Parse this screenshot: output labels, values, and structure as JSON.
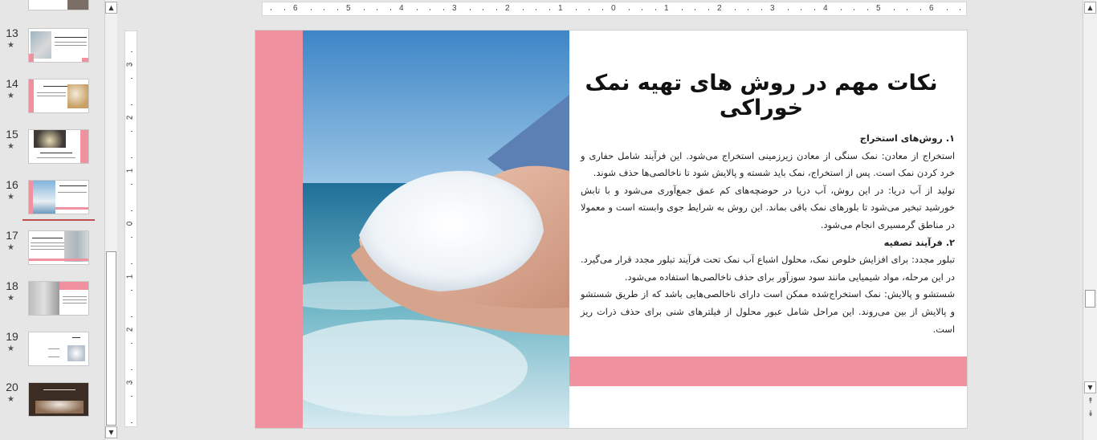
{
  "thumbnails": [
    {
      "number": "13",
      "star": "★"
    },
    {
      "number": "14",
      "star": "★"
    },
    {
      "number": "15",
      "star": "★"
    },
    {
      "number": "16",
      "star": "★"
    },
    {
      "number": "17",
      "star": "★"
    },
    {
      "number": "18",
      "star": "★"
    },
    {
      "number": "19",
      "star": "★"
    },
    {
      "number": "20",
      "star": "★"
    }
  ],
  "ruler": {
    "horizontal": [
      "6",
      "5",
      "4",
      "3",
      "2",
      "1",
      "0",
      "1",
      "2",
      "3",
      "4",
      "5",
      "6"
    ],
    "vertical": [
      "3",
      "2",
      "1",
      "0",
      "1",
      "2",
      "3"
    ]
  },
  "slide": {
    "title": "نکات مهم در روش های تهیه نمک خوراکی",
    "sections": [
      {
        "heading": "۱. روش‌های استخراج"
      },
      {
        "text": "استخراج از معادن: نمک سنگی از معادن زیرزمینی استخراج می‌شود. این فرآیند شامل حفاری و خرد کردن نمک است. پس از استخراج، نمک باید شسته و پالایش شود تا ناخالصی‌ها حذف شوند."
      },
      {
        "text": "تولید از آب دریا: در این روش، آب دریا در حوضچه‌های کم عمق جمع‌آوری می‌شود و با تابش خورشید تبخیر می‌شود تا بلورهای نمک باقی بماند. این روش به شرایط جوی وابسته است و معمولا در مناطق گرمسیری انجام می‌شود."
      },
      {
        "heading": "۲. فرآیند تصفیه"
      },
      {
        "text": "تبلور مجدد: برای افزایش خلوص نمک، محلول اشباع آب نمک تحت فرآیند تبلور مجدد قرار می‌گیرد. در این مرحله، مواد شیمیایی مانند سود سوزآور برای حذف ناخالصی‌ها استفاده می‌شود."
      },
      {
        "text": "شستشو و پالایش: نمک استخراج‌شده ممکن است دارای ناخالصی‌هایی باشد که از طریق شستشو و پالایش از بین می‌روند. این مراحل شامل عبور محلول از فیلترهای شنی برای حذف ذرات ریز است."
      }
    ]
  },
  "colors": {
    "accent_pink": "#ef919f",
    "selection_red": "#c0504d",
    "workspace": "#e6e6e6"
  },
  "icons": {
    "scroll_up": "▲",
    "scroll_down": "▼",
    "prev_slide": "⯭",
    "next_slide": "⯯"
  }
}
